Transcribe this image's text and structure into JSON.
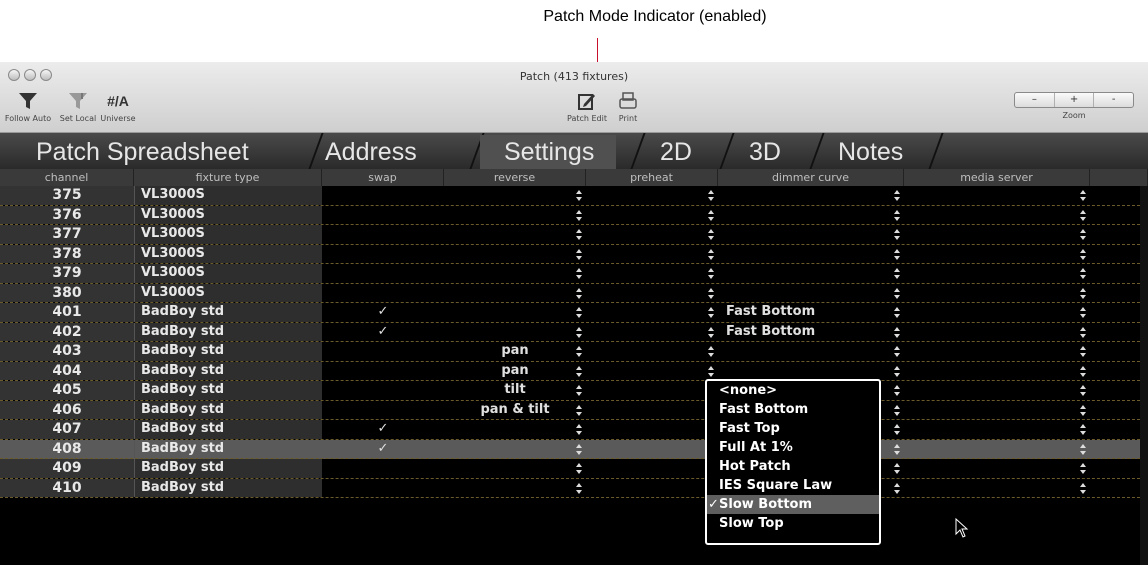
{
  "annotation": "Patch Mode Indicator (enabled)",
  "window": {
    "title": "Patch (413 fixtures)"
  },
  "toolbar": {
    "follow_auto": "Follow Auto",
    "set_local": "Set Local",
    "universe": "Universe",
    "universe_icon": "#/A",
    "patch_edit": "Patch Edit",
    "print": "Print",
    "zoom": "Zoom",
    "zoom_minus": "–",
    "zoom_plus": "+",
    "zoom_dash": "-"
  },
  "tabs": [
    "Patch Spreadsheet",
    "Address",
    "Settings",
    "2D",
    "3D",
    "Notes"
  ],
  "active_tab": "Settings",
  "columns": [
    "channel",
    "fixture type",
    "swap",
    "reverse",
    "preheat",
    "dimmer curve",
    "media server"
  ],
  "rows": [
    {
      "channel": "375",
      "fixture": "VL3000S",
      "swap": "",
      "reverse": "",
      "dimmer": ""
    },
    {
      "channel": "376",
      "fixture": "VL3000S",
      "swap": "",
      "reverse": "",
      "dimmer": ""
    },
    {
      "channel": "377",
      "fixture": "VL3000S",
      "swap": "",
      "reverse": "",
      "dimmer": ""
    },
    {
      "channel": "378",
      "fixture": "VL3000S",
      "swap": "",
      "reverse": "",
      "dimmer": ""
    },
    {
      "channel": "379",
      "fixture": "VL3000S",
      "swap": "",
      "reverse": "",
      "dimmer": ""
    },
    {
      "channel": "380",
      "fixture": "VL3000S",
      "swap": "",
      "reverse": "",
      "dimmer": ""
    },
    {
      "channel": "401",
      "fixture": "BadBoy std",
      "swap": "✓",
      "reverse": "",
      "dimmer": "Fast Bottom"
    },
    {
      "channel": "402",
      "fixture": "BadBoy std",
      "swap": "✓",
      "reverse": "",
      "dimmer": "Fast Bottom"
    },
    {
      "channel": "403",
      "fixture": "BadBoy std",
      "swap": "",
      "reverse": "pan",
      "dimmer": ""
    },
    {
      "channel": "404",
      "fixture": "BadBoy std",
      "swap": "",
      "reverse": "pan",
      "dimmer": ""
    },
    {
      "channel": "405",
      "fixture": "BadBoy std",
      "swap": "",
      "reverse": "tilt",
      "dimmer": ""
    },
    {
      "channel": "406",
      "fixture": "BadBoy std",
      "swap": "",
      "reverse": "pan & tilt",
      "dimmer": ""
    },
    {
      "channel": "407",
      "fixture": "BadBoy std",
      "swap": "✓",
      "reverse": "",
      "dimmer": ""
    },
    {
      "channel": "408",
      "fixture": "BadBoy std",
      "swap": "✓",
      "reverse": "",
      "dimmer": ""
    },
    {
      "channel": "409",
      "fixture": "BadBoy std",
      "swap": "",
      "reverse": "",
      "dimmer": ""
    },
    {
      "channel": "410",
      "fixture": "BadBoy std",
      "swap": "",
      "reverse": "",
      "dimmer": ""
    }
  ],
  "selected_row_channel": "408",
  "dropdown": {
    "options": [
      "<none>",
      "Fast Bottom",
      "Fast Top",
      "Full At 1%",
      "Hot Patch",
      "IES Square Law",
      "Slow Bottom",
      "Slow Top"
    ],
    "selected": "Slow Bottom",
    "check": "✓"
  },
  "colors": {
    "row_separator": "#6b5a2a",
    "annotation_line": "#c8102e",
    "selected_row": "#5a5a5a"
  }
}
